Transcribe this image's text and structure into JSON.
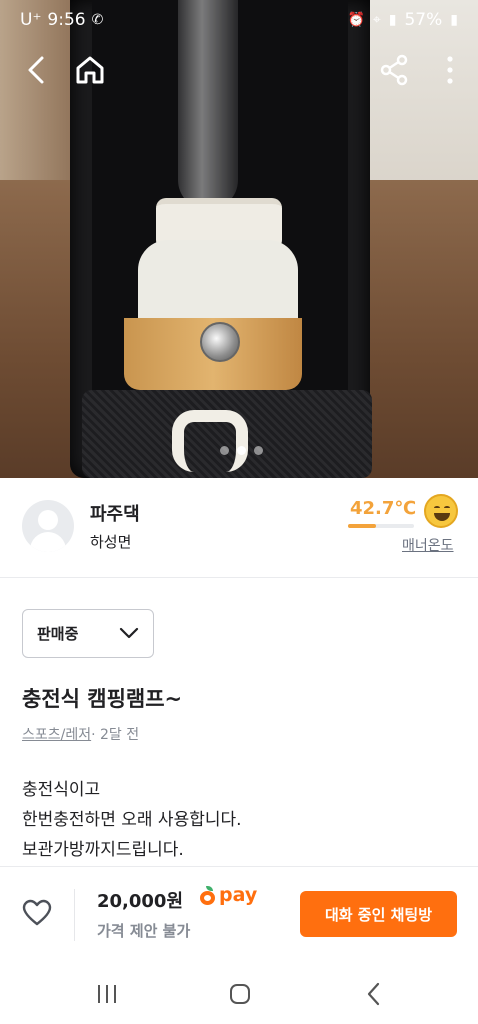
{
  "status_bar": {
    "carrier": "U⁺",
    "time": "9:56",
    "battery": "57%"
  },
  "seller": {
    "name": "파주댁",
    "region": "하성면",
    "temperature": "42.7℃",
    "temperature_level": 0.427,
    "manner_label": "매너온도"
  },
  "product": {
    "status": "판매중",
    "title": "충전식 캠핑램프~",
    "category": "스포츠/레저",
    "time_ago": "· 2달 전",
    "description": [
      "충전식이고",
      "한번충전하면 오래 사용합니다.",
      "보관가방까지드립니다."
    ],
    "image_count": 3,
    "current_image": 1
  },
  "bottom_bar": {
    "price": "20,000원",
    "pay_label": "pay",
    "negotiation": "가격 제안 불가",
    "chat_button": "대화 중인 채팅방"
  },
  "colors": {
    "accent": "#ff6f0f",
    "temperature": "#f3a33b"
  },
  "icons": [
    "back-icon",
    "home-icon",
    "share-icon",
    "more-icon",
    "heart-icon",
    "chevron-down-icon"
  ]
}
